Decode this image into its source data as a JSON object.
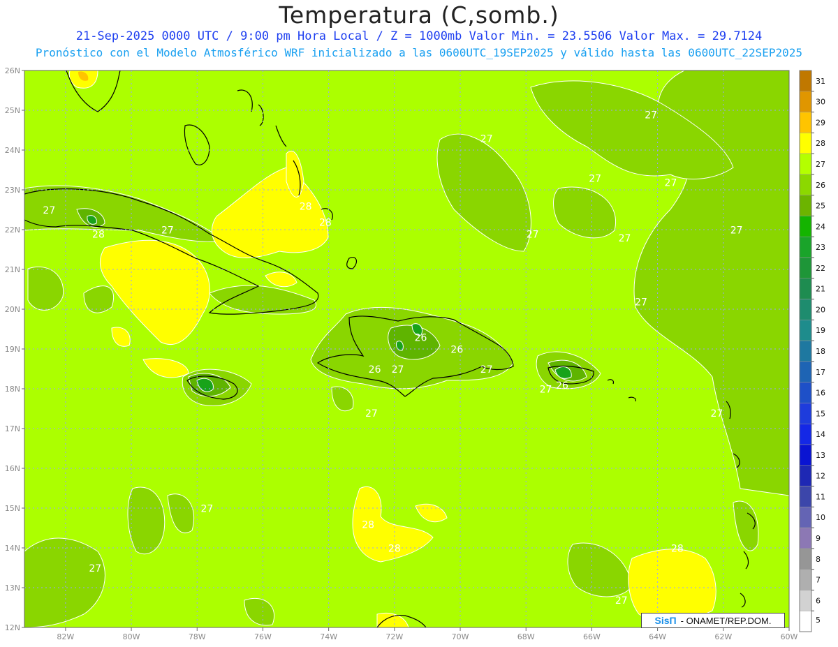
{
  "header": {
    "title": "Temperatura (C,somb.)",
    "line1": "21-Sep-2025  0000 UTC / 9:00 pm Hora Local / Z = 1000mb   Valor Min. = 23.5506  Valor Max. = 29.7124",
    "line2": "Pronóstico con el Modelo Atmosférico WRF inicializado a las 0600UTC_19SEP2025 y válido hasta las  0600UTC_22SEP2025"
  },
  "map": {
    "lon_ticks": [
      "82W",
      "80W",
      "78W",
      "76W",
      "74W",
      "72W",
      "70W",
      "68W",
      "66W",
      "64W",
      "62W",
      "60W"
    ],
    "lat_ticks": [
      "26N",
      "25N",
      "24N",
      "23N",
      "22N",
      "21N",
      "20N",
      "19N",
      "18N",
      "17N",
      "16N",
      "15N",
      "14N",
      "13N",
      "12N"
    ],
    "contour_labels": [
      {
        "text": "27",
        "lon": -82.5,
        "lat": 22.4
      },
      {
        "text": "27",
        "lon": -78.9,
        "lat": 21.9
      },
      {
        "text": "28",
        "lon": -81.0,
        "lat": 21.8
      },
      {
        "text": "28",
        "lon": -74.7,
        "lat": 22.5
      },
      {
        "text": "28",
        "lon": -74.1,
        "lat": 22.1
      },
      {
        "text": "27",
        "lon": -69.2,
        "lat": 24.2
      },
      {
        "text": "27",
        "lon": -65.9,
        "lat": 23.2
      },
      {
        "text": "27",
        "lon": -64.2,
        "lat": 24.8
      },
      {
        "text": "27",
        "lon": -63.6,
        "lat": 23.1
      },
      {
        "text": "27",
        "lon": -61.6,
        "lat": 21.9
      },
      {
        "text": "27",
        "lon": -65.0,
        "lat": 21.7
      },
      {
        "text": "27",
        "lon": -67.8,
        "lat": 21.8
      },
      {
        "text": "27",
        "lon": -64.5,
        "lat": 20.1
      },
      {
        "text": "26",
        "lon": -71.2,
        "lat": 19.2
      },
      {
        "text": "26",
        "lon": -70.1,
        "lat": 18.9
      },
      {
        "text": "26",
        "lon": -72.6,
        "lat": 18.4
      },
      {
        "text": "27",
        "lon": -71.9,
        "lat": 18.4
      },
      {
        "text": "27",
        "lon": -69.2,
        "lat": 18.4
      },
      {
        "text": "27",
        "lon": -72.7,
        "lat": 17.3
      },
      {
        "text": "27",
        "lon": -67.4,
        "lat": 17.9
      },
      {
        "text": "26",
        "lon": -66.9,
        "lat": 18.0
      },
      {
        "text": "27",
        "lon": -62.2,
        "lat": 17.3
      },
      {
        "text": "27",
        "lon": -77.7,
        "lat": 14.9
      },
      {
        "text": "28",
        "lon": -72.8,
        "lat": 14.5
      },
      {
        "text": "28",
        "lon": -72.0,
        "lat": 13.9
      },
      {
        "text": "27",
        "lon": -81.1,
        "lat": 13.4
      },
      {
        "text": "28",
        "lon": -63.4,
        "lat": 13.9
      },
      {
        "text": "27",
        "lon": -65.1,
        "lat": 12.6
      }
    ]
  },
  "colorbar": {
    "labels": [
      "31",
      "30",
      "29",
      "28",
      "27",
      "26",
      "25",
      "24",
      "23",
      "22",
      "21",
      "20",
      "19",
      "18",
      "17",
      "16",
      "15",
      "14",
      "13",
      "12",
      "11",
      "10",
      "9",
      "8",
      "7",
      "6",
      "5"
    ],
    "colors": [
      "#c07800",
      "#e09600",
      "#ffc400",
      "#ffff00",
      "#b4ff00",
      "#8cd800",
      "#6cb400",
      "#14b400",
      "#1aa42a",
      "#1e9638",
      "#1e8c50",
      "#1e8c6e",
      "#1e8c8c",
      "#1e78a0",
      "#1e64b4",
      "#1e50c8",
      "#1e3cdc",
      "#1428e6",
      "#0a14d2",
      "#1e28b4",
      "#3c46aa",
      "#6464b4",
      "#8c78b4",
      "#969696",
      "#afafaf",
      "#d2d2d2",
      "#ffffff"
    ]
  },
  "fill_colors": {
    "sea": "#acff00",
    "cool": "#8ad600",
    "cooler": "#5fb400",
    "coldest": "#18a31a",
    "warm": "#ffff00",
    "hot": "#ffc400",
    "grid": "#9aa0ff",
    "axis_label": "#888888"
  },
  "credit": {
    "brand": "SisΠ",
    "org": "- ONAMET/REP.DOM."
  }
}
